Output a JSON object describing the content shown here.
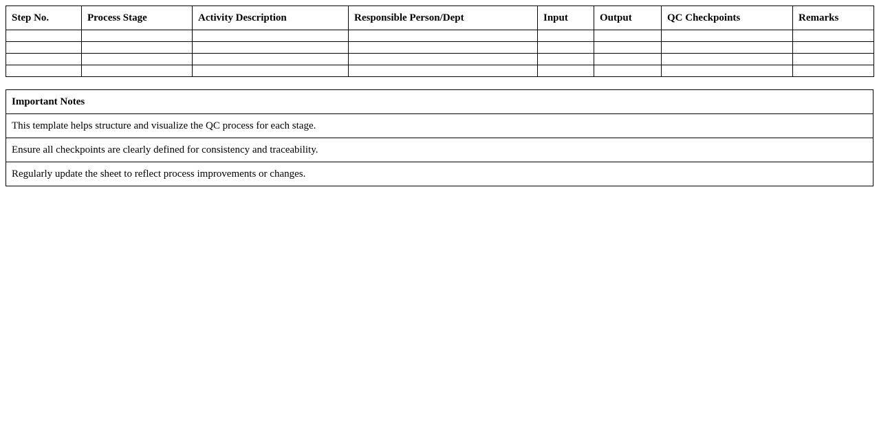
{
  "process_table": {
    "headers": [
      "Step No.",
      "Process Stage",
      "Activity Description",
      "Responsible Person/Dept",
      "Input",
      "Output",
      "QC Checkpoints",
      "Remarks"
    ],
    "rows": [
      [
        "",
        "",
        "",
        "",
        "",
        "",
        "",
        ""
      ],
      [
        "",
        "",
        "",
        "",
        "",
        "",
        "",
        ""
      ],
      [
        "",
        "",
        "",
        "",
        "",
        "",
        "",
        ""
      ],
      [
        "",
        "",
        "",
        "",
        "",
        "",
        "",
        ""
      ]
    ]
  },
  "notes": {
    "title": "Important Notes",
    "items": [
      "This template helps structure and visualize the QC process for each stage.",
      "Ensure all checkpoints are clearly defined for consistency and traceability.",
      "Regularly update the sheet to reflect process improvements or changes."
    ]
  }
}
